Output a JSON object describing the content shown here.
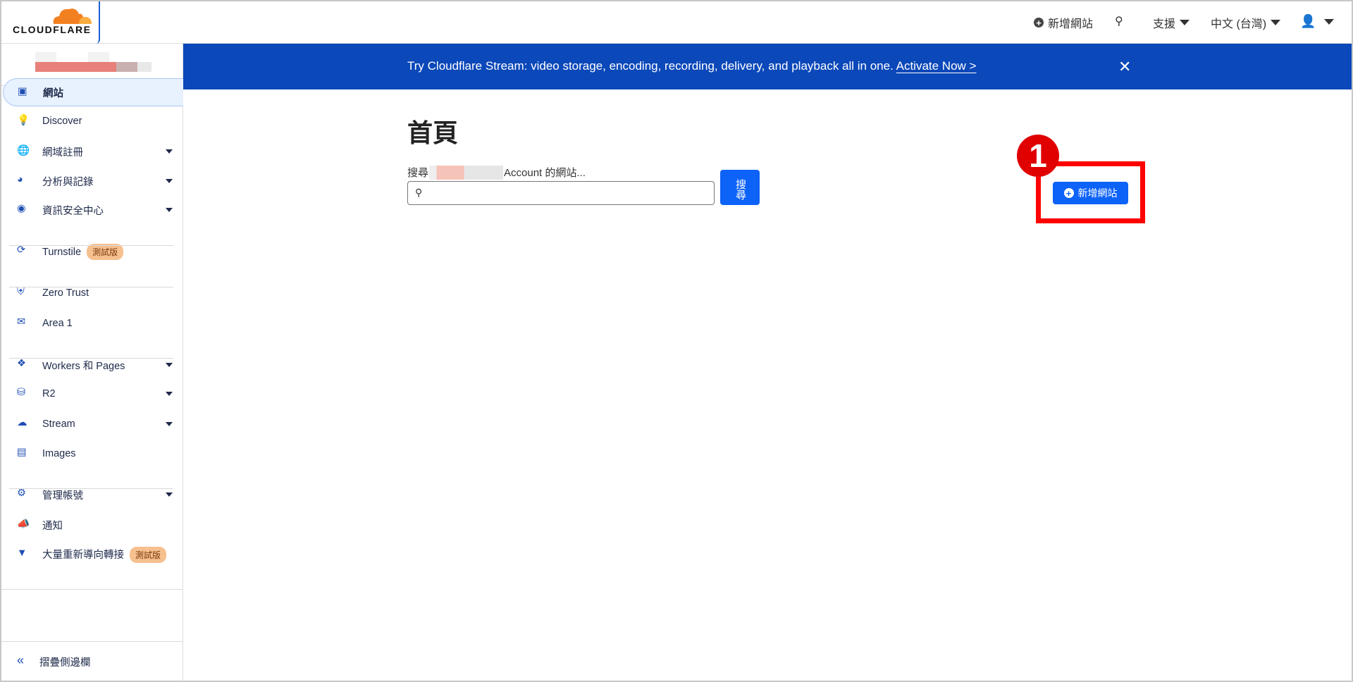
{
  "header": {
    "logo": "CLOUDFLARE",
    "add_site": "新增網站",
    "support": "支援",
    "language": "中文 (台灣)"
  },
  "sidebar": {
    "items": [
      {
        "label": "網站",
        "icon": "browser-window-icon"
      },
      {
        "label": "Discover",
        "icon": "lightbulb-icon"
      },
      {
        "label": "網域註冊",
        "icon": "globe-icon"
      },
      {
        "label": "分析與記錄",
        "icon": "pie-chart-icon"
      },
      {
        "label": "資訊安全中心",
        "icon": "security-center-icon"
      },
      {
        "label": "Turnstile",
        "icon": "turnstile-icon",
        "badge": "測試版"
      },
      {
        "label": "Zero Trust",
        "icon": "shield-icon"
      },
      {
        "label": "Area 1",
        "icon": "mail-icon"
      },
      {
        "label": "Workers 和 Pages",
        "icon": "workers-icon"
      },
      {
        "label": "R2",
        "icon": "database-icon"
      },
      {
        "label": "Stream",
        "icon": "cloud-play-icon"
      },
      {
        "label": "Images",
        "icon": "image-icon"
      },
      {
        "label": "管理帳號",
        "icon": "gear-icon"
      },
      {
        "label": "通知",
        "icon": "megaphone-icon"
      },
      {
        "label": "大量重新導向轉接",
        "icon": "funnel-icon",
        "badge": "測試版"
      }
    ],
    "collapse": "摺疊側邊欄"
  },
  "banner": {
    "text": "Try Cloudflare Stream: video storage, encoding, recording, delivery, and playback all in one.",
    "link": "Activate Now >"
  },
  "main": {
    "title": "首頁",
    "search_prefix": "搜尋",
    "search_suffix": "Account 的網站...",
    "search_value": "",
    "search_button": "搜尋",
    "add_site_button": "新增網站"
  },
  "annotation": {
    "step": "1",
    "color": "#ff0000"
  },
  "colors": {
    "brand_orange": "#f38020",
    "primary": "#0d62f7",
    "banner": "#0b48b9"
  }
}
